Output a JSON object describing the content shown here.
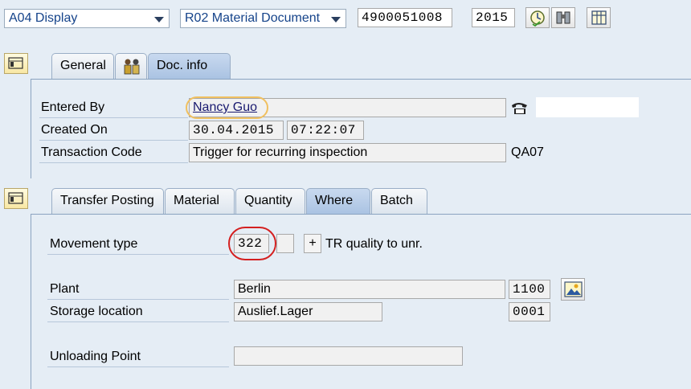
{
  "toolbar": {
    "action_select": "A04 Display",
    "document_select": "R02 Material Document",
    "document_number": "4900051008",
    "year": "2015",
    "icons": [
      "clock-check-icon",
      "binoculars-icon",
      "table-layout-icon"
    ]
  },
  "header_tabs": [
    {
      "label": "General",
      "active": false
    },
    {
      "label": "",
      "icon": "people-icon",
      "active": false
    },
    {
      "label": "Doc. info",
      "active": true
    }
  ],
  "doc_info": {
    "entered_by_label": "Entered By",
    "entered_by_value": "Nancy Guo",
    "created_on_label": "Created On",
    "created_on_date": "30.04.2015",
    "created_on_time": "07:22:07",
    "transaction_code_label": "Transaction Code",
    "transaction_code_value": "Trigger for recurring inspection",
    "transaction_code": "QA07",
    "contact_icon": "telephone-icon"
  },
  "item_tabs": [
    {
      "label": "Transfer Posting",
      "active": false
    },
    {
      "label": "Material",
      "active": false
    },
    {
      "label": "Quantity",
      "active": false
    },
    {
      "label": "Where",
      "active": true
    },
    {
      "label": "Batch",
      "active": false
    }
  ],
  "where": {
    "movement_type_label": "Movement type",
    "movement_type_value": "322",
    "movement_sign": "+",
    "movement_type_text": "TR quality to unr.",
    "plant_label": "Plant",
    "plant_name": "Berlin",
    "plant_code": "1100",
    "storage_location_label": "Storage location",
    "storage_location_name": "Auslief.Lager",
    "storage_location_code": "0001",
    "unloading_point_label": "Unloading Point",
    "unloading_point_value": ""
  },
  "highlight_colors": {
    "entered_by_ring": "#f0c060",
    "movement_type_ring": "#d42020"
  }
}
